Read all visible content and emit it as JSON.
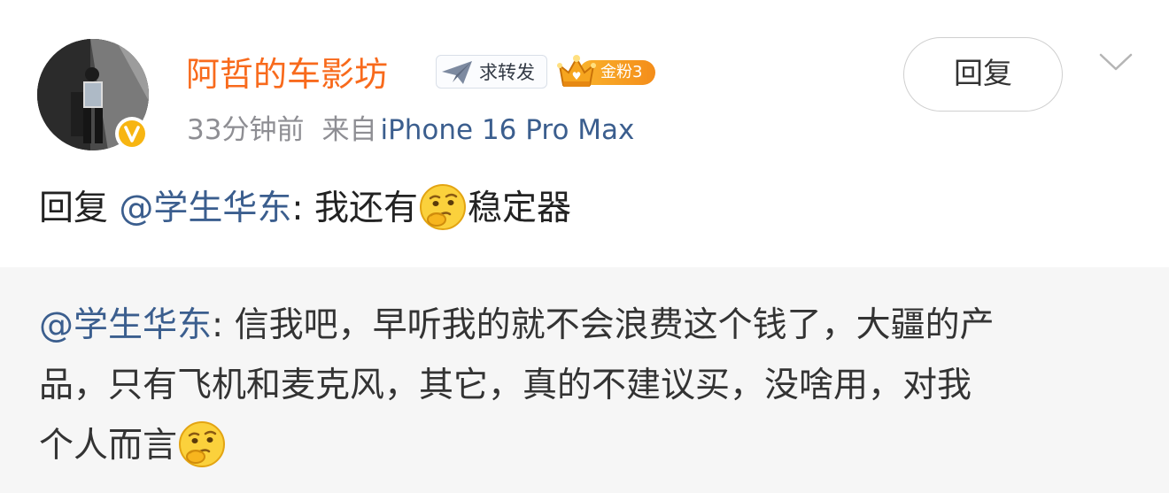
{
  "post": {
    "username": "阿哲的车影坊",
    "repost_tag": "求转发",
    "fan_badge": "金粉3",
    "time": "33分钟前",
    "source_prefix": "来自",
    "device": "iPhone 16 Pro Max",
    "reply_button": "回复",
    "verified": true
  },
  "comment": {
    "prefix": "回复 ",
    "mention": "@学生华东",
    "colon": ": ",
    "text_before_emoji": "我还有",
    "emoji": "thinking-face-emoji",
    "text_after_emoji": "稳定器"
  },
  "quoted": {
    "mention": "@学生华东",
    "colon": ": ",
    "line1_text": "信我吧，早听我的就不会浪费这个钱了，大疆的产",
    "line2_text": "品，只有飞机和麦克风，其它，真的不建议买，没啥用，对我",
    "line3_text": "个人而言",
    "emoji": "thinking-face-emoji"
  },
  "colors": {
    "username": "#f86a1c",
    "link": "#3b5e8e",
    "meta": "#8e8e93",
    "quote_background": "#f6f6f6",
    "badge_orange": "#f48d1a",
    "verified_yellow": "#f7b512"
  },
  "icons": {
    "repost": "paper-plane-icon",
    "fan_badge": "crown-icon",
    "verified": "verified-v-icon",
    "menu": "chevron-down-icon"
  }
}
